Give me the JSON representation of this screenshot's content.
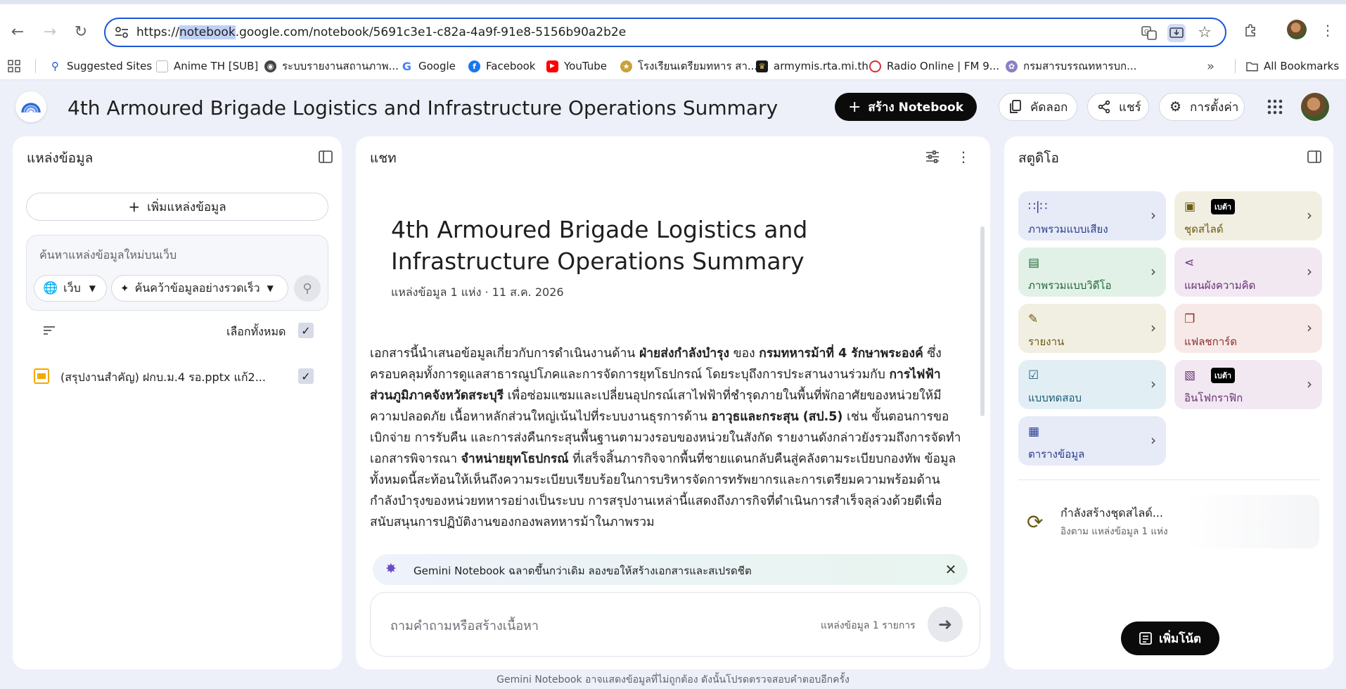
{
  "browser": {
    "url_prefix": "https://",
    "url_highlight": "notebook",
    "url_rest": ".google.com/notebook/5691c3e1-c82a-4a9f-91e8-5156b90a2b2e",
    "bookmarks": [
      {
        "label": "Suggested Sites",
        "icon": "magnifier-icon"
      },
      {
        "label": "Anime TH [SUB]",
        "icon": "blank-page-icon"
      },
      {
        "label": "ระบบรายงานสถานภาพ...",
        "icon": "globe-icon"
      },
      {
        "label": "Google",
        "icon": "google-icon"
      },
      {
        "label": "Facebook",
        "icon": "facebook-icon"
      },
      {
        "label": "YouTube",
        "icon": "youtube-icon"
      },
      {
        "label": "โรงเรียนเตรียมทหาร สา...",
        "icon": "school-emblem-icon"
      },
      {
        "label": "armymis.rta.mi.th",
        "icon": "army-emblem-icon"
      },
      {
        "label": "Radio Online | FM 9...",
        "icon": "radio-icon"
      },
      {
        "label": "กรมสารบรรณทหารบก...",
        "icon": "department-emblem-icon"
      }
    ],
    "overflow": "»",
    "all_bookmarks": "All Bookmarks"
  },
  "header": {
    "title": "4th Armoured Brigade Logistics and Infrastructure Operations Summary",
    "create_notebook": "สร้าง Notebook",
    "copy": "คัดลอก",
    "share": "แชร์",
    "settings": "การตั้งค่า"
  },
  "sources": {
    "title": "แหล่งข้อมูล",
    "add_source": "เพิ่มแหล่งข้อมูล",
    "search_placeholder": "ค้นหาแหล่งข้อมูลใหม่บนเว็บ",
    "web_option": "เว็บ",
    "research_option": "ค้นคว้าข้อมูลอย่างรวดเร็ว",
    "select_all": "เลือกทั้งหมด",
    "items": [
      {
        "label": "(สรุปงานสำคัญ) ฝกบ.ม.4 รอ.pptx แก้2...",
        "checked": true
      }
    ]
  },
  "chat": {
    "title": "แชท",
    "doc_title": "4th Armoured Brigade Logistics and Infrastructure Operations Summary",
    "doc_meta": "แหล่งข้อมูล 1 แห่ง · 11 ส.ค. 2026",
    "summary": [
      {
        "t": "เอกสารนี้นำเสนอข้อมูลเกี่ยวกับการดำเนินงานด้าน ",
        "b": false
      },
      {
        "t": "ฝ่ายส่งกำลังบำรุง",
        "b": true
      },
      {
        "t": " ของ ",
        "b": false
      },
      {
        "t": "กรมทหารม้าที่ 4 รักษาพระองค์",
        "b": true
      },
      {
        "t": " ซึ่งครอบคลุมทั้งการดูแลสาธารณูปโภคและการจัดการยุทโธปกรณ์ โดยระบุถึงการประสานงานร่วมกับ ",
        "b": false
      },
      {
        "t": "การไฟฟ้าส่วนภูมิภาคจังหวัดสระบุรี",
        "b": true
      },
      {
        "t": " เพื่อซ่อมแซมและเปลี่ยนอุปกรณ์เสาไฟฟ้าที่ชำรุดภายในพื้นที่พักอาศัยของหน่วยให้มีความปลอดภัย เนื้อหาหลักส่วนใหญ่เน้นไปที่ระบบงานธุรการด้าน ",
        "b": false
      },
      {
        "t": "อาวุธและกระสุน (สป.5)",
        "b": true
      },
      {
        "t": " เช่น ขั้นตอนการขอเบิกจ่าย การรับคืน และการส่งคืนกระสุนพื้นฐานตามวงรอบของหน่วยในสังกัด รายงานดังกล่าวยังรวมถึงการจัดทำเอกสารพิจารณา ",
        "b": false
      },
      {
        "t": "จำหน่ายยุทโธปกรณ์",
        "b": true
      },
      {
        "t": " ที่เสร็จสิ้นภารกิจจากพื้นที่ชายแดนกลับคืนสู่คลังตามระเบียบกองทัพ ข้อมูลทั้งหมดนี้สะท้อนให้เห็นถึงความระเบียบเรียบร้อยในการบริหารจัดการทรัพยากรและการเตรียมความพร้อมด้านกำลังบำรุงของหน่วยทหารอย่างเป็นระบบ การสรุปงานเหล่านี้แสดงถึงภารกิจที่ดำเนินการสำเร็จลุล่วงด้วยดีเพื่อสนับสนุนการปฏิบัติงานของกองพลทหารม้าในภาพรวม",
        "b": false
      }
    ],
    "banner": "Gemini Notebook ฉลาดขึ้นกว่าเดิม ลองขอให้สร้างเอกสารและสเปรดชีต",
    "input_placeholder": "ถามคำถามหรือสร้างเนื้อหา",
    "source_count": "แหล่งข้อมูล 1 รายการ"
  },
  "studio": {
    "title": "สตูดิโอ",
    "cards": [
      {
        "label": "ภาพรวมแบบเสียง",
        "icon": "audio-waveform-icon",
        "bg": "#e7eaf7",
        "fg": "#2a3f8f",
        "beta": ""
      },
      {
        "label": "ชุดสไลด์",
        "icon": "slides-icon",
        "bg": "#f1efe1",
        "fg": "#6b5a12",
        "beta": "เบต้า"
      },
      {
        "label": "ภาพรวมแบบวิดีโอ",
        "icon": "video-icon",
        "bg": "#e2f1e7",
        "fg": "#1f6a3a",
        "beta": ""
      },
      {
        "label": "แผนผังความคิด",
        "icon": "mind-map-icon",
        "bg": "#f1e8f2",
        "fg": "#6a2d74",
        "beta": ""
      },
      {
        "label": "รายงาน",
        "icon": "report-icon",
        "bg": "#f1efe1",
        "fg": "#6b5a12",
        "beta": ""
      },
      {
        "label": "แฟลชการ์ด",
        "icon": "flashcards-icon",
        "bg": "#f7e9e8",
        "fg": "#8a2f2a",
        "beta": ""
      },
      {
        "label": "แบบทดสอบ",
        "icon": "quiz-icon",
        "bg": "#e1eff5",
        "fg": "#1c5b78",
        "beta": ""
      },
      {
        "label": "อินโฟกราฟิก",
        "icon": "infographic-icon",
        "bg": "#f1e8f2",
        "fg": "#6a2d74",
        "beta": "เบต้า"
      },
      {
        "label": "ตารางข้อมูล",
        "icon": "data-table-icon",
        "bg": "#e7eaf7",
        "fg": "#2a3f8f",
        "beta": ""
      }
    ],
    "generating_title": "กำลังสร้างชุดสไลด์...",
    "generating_sub": "อิงตาม แหล่งข้อมูล 1 แห่ง",
    "add_note": "เพิ่มโน้ต"
  },
  "footer": "Gemini Notebook อาจแสดงข้อมูลที่ไม่ถูกต้อง ดังนั้นโปรดตรวจสอบคำตอบอีกครั้ง"
}
